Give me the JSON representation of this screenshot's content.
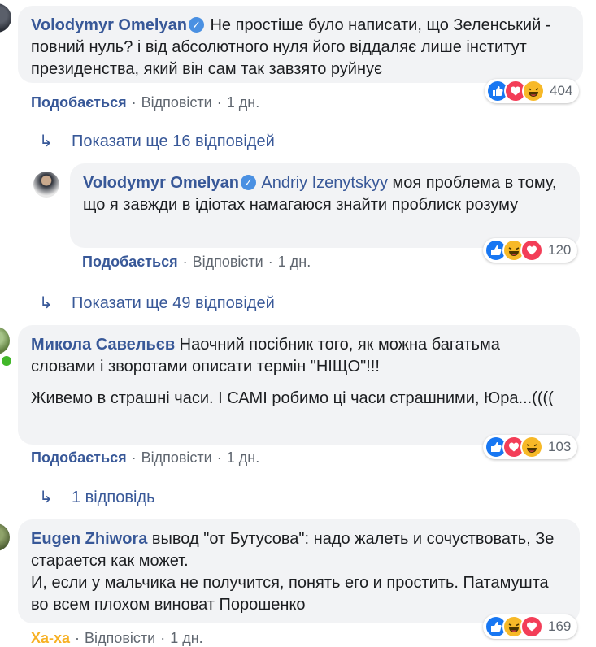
{
  "comments": [
    {
      "author": "Volodymyr Omelyan",
      "verified": true,
      "text": "Не простіше було написати, що Зеленський - повний нуль? і від абсолютного нуля його віддаляє лише інститут президенства, який він сам так завзято руйнує",
      "actions": {
        "like": "Подобається",
        "reply": "Відповісти",
        "time": "1 дн."
      },
      "reactions": [
        "like",
        "love",
        "haha"
      ],
      "reaction_count": "404"
    },
    {
      "author": "Volodymyr Omelyan",
      "verified": true,
      "mention": "Andriy Izenytskyy",
      "text": "моя проблема в тому, що я завжди в ідіотах намагаюся знайти проблиск розуму",
      "actions": {
        "like": "Подобається",
        "reply": "Відповісти",
        "time": "1 дн."
      },
      "reactions": [
        "like",
        "haha",
        "love"
      ],
      "reaction_count": "120"
    },
    {
      "author": "Микола Савельєв",
      "verified": false,
      "text": "Наочний посібник того, як можна багатьма словами і зворотами описати термін \"НІЩО\"!!!",
      "text2": "Живемо в страшні часи. І САМІ робимо ці часи страшними, Юра...((((",
      "actions": {
        "like": "Подобається",
        "reply": "Відповісти",
        "time": "1 дн."
      },
      "reactions": [
        "like",
        "love",
        "haha"
      ],
      "reaction_count": "103"
    },
    {
      "author": "Eugen Zhiwora",
      "verified": false,
      "text": "вывод \"от Бутусова\": надо жалеть и сочуствовать, Зе старается как может.",
      "text2": "И, если у мальчика не получится, понять его и простить. Патамушта во всем плохом виноват Порошенко",
      "actions": {
        "like": "Ха-ха",
        "reply": "Відповісти",
        "time": "1 дн."
      },
      "reactions": [
        "like",
        "haha",
        "love"
      ],
      "reaction_count": "169"
    }
  ],
  "more_replies": [
    "Показати ще 16 відповідей",
    "Показати ще 49 відповідей",
    "1 відповідь"
  ],
  "colors": {
    "link": "#385898",
    "bubble": "#f2f3f5",
    "like": "#1877f2",
    "love": "#f33e58",
    "haha": "#f7b928"
  }
}
